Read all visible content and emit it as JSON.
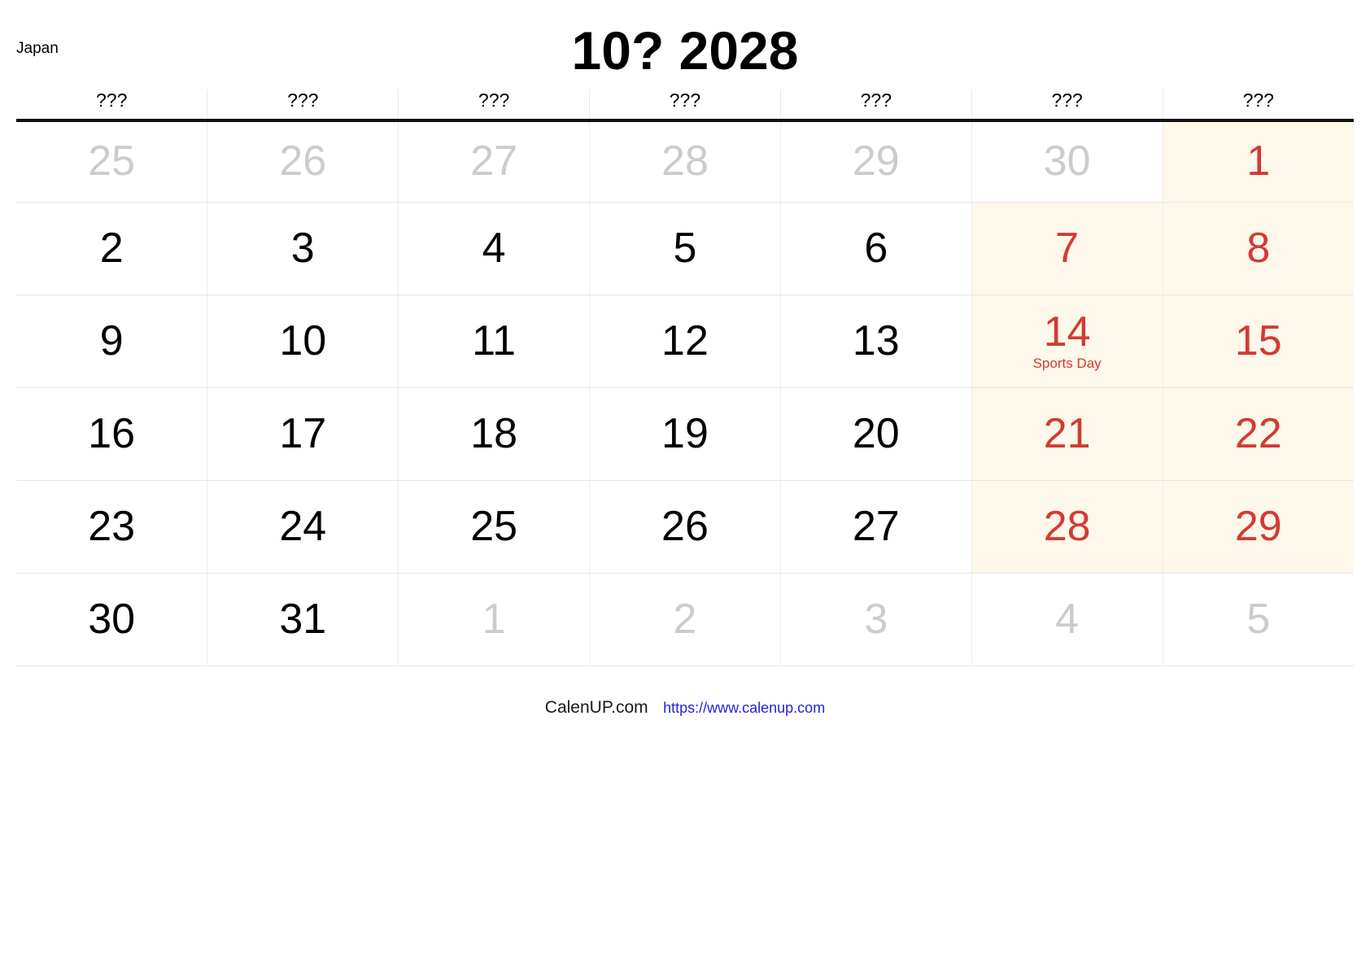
{
  "header": {
    "country": "Japan",
    "title": "10? 2028"
  },
  "colors": {
    "weekend_bg": "#fdf8ea",
    "holiday_red": "#d33a33",
    "other_month_gray": "#cccccc",
    "link_blue": "#2222dd",
    "header_rule": "#111111"
  },
  "weekday_headers": [
    "???",
    "???",
    "???",
    "???",
    "???",
    "???",
    "???"
  ],
  "weeks": [
    [
      {
        "day": "25",
        "type": "other"
      },
      {
        "day": "26",
        "type": "other"
      },
      {
        "day": "27",
        "type": "other"
      },
      {
        "day": "28",
        "type": "other"
      },
      {
        "day": "29",
        "type": "other"
      },
      {
        "day": "30",
        "type": "other"
      },
      {
        "day": "1",
        "type": "red",
        "weekend": true
      }
    ],
    [
      {
        "day": "2",
        "type": "normal"
      },
      {
        "day": "3",
        "type": "normal"
      },
      {
        "day": "4",
        "type": "normal"
      },
      {
        "day": "5",
        "type": "normal"
      },
      {
        "day": "6",
        "type": "normal"
      },
      {
        "day": "7",
        "type": "red",
        "weekend": true
      },
      {
        "day": "8",
        "type": "red",
        "weekend": true
      }
    ],
    [
      {
        "day": "9",
        "type": "normal"
      },
      {
        "day": "10",
        "type": "normal"
      },
      {
        "day": "11",
        "type": "normal"
      },
      {
        "day": "12",
        "type": "normal"
      },
      {
        "day": "13",
        "type": "normal"
      },
      {
        "day": "14",
        "type": "red",
        "weekend": true,
        "holiday": "Sports Day"
      },
      {
        "day": "15",
        "type": "red",
        "weekend": true
      }
    ],
    [
      {
        "day": "16",
        "type": "normal"
      },
      {
        "day": "17",
        "type": "normal"
      },
      {
        "day": "18",
        "type": "normal"
      },
      {
        "day": "19",
        "type": "normal"
      },
      {
        "day": "20",
        "type": "normal"
      },
      {
        "day": "21",
        "type": "red",
        "weekend": true
      },
      {
        "day": "22",
        "type": "red",
        "weekend": true
      }
    ],
    [
      {
        "day": "23",
        "type": "normal"
      },
      {
        "day": "24",
        "type": "normal"
      },
      {
        "day": "25",
        "type": "normal"
      },
      {
        "day": "26",
        "type": "normal"
      },
      {
        "day": "27",
        "type": "normal"
      },
      {
        "day": "28",
        "type": "red",
        "weekend": true
      },
      {
        "day": "29",
        "type": "red",
        "weekend": true
      }
    ],
    [
      {
        "day": "30",
        "type": "normal"
      },
      {
        "day": "31",
        "type": "normal"
      },
      {
        "day": "1",
        "type": "other"
      },
      {
        "day": "2",
        "type": "other"
      },
      {
        "day": "3",
        "type": "other"
      },
      {
        "day": "4",
        "type": "other"
      },
      {
        "day": "5",
        "type": "other"
      }
    ]
  ],
  "footer": {
    "brand": "CalenUP.com",
    "url": "https://www.calenup.com"
  }
}
